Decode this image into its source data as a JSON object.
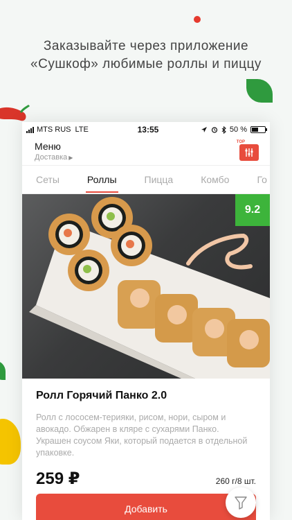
{
  "promo": {
    "line1": "Заказывайте через приложение",
    "line2": "«Сушкоф» любимые роллы и пиццу"
  },
  "status_bar": {
    "carrier": "MTS RUS",
    "network": "LTE",
    "time": "13:55",
    "battery": "50 %",
    "battery_level": 0.5
  },
  "header": {
    "title": "Меню",
    "delivery": "Доставка",
    "top_badge": "TOP"
  },
  "tabs": [
    {
      "label": "Сеты",
      "active": false
    },
    {
      "label": "Роллы",
      "active": true
    },
    {
      "label": "Пицца",
      "active": false
    },
    {
      "label": "Комбо",
      "active": false
    },
    {
      "label": "Го",
      "active": false
    }
  ],
  "product": {
    "rating": "9.2",
    "title": "Ролл Горячий Панко 2.0",
    "description": "Ролл с лососем-терияки, рисом,  нори, сыром и авокадо. Обжарен в кляре с сухарями Панко. Украшен соусом Яки, который подается в отдельной упаковке.",
    "price": "259 ₽",
    "weight": "260 г/8 шт.",
    "add_label": "Добавить"
  },
  "colors": {
    "accent": "#e84c3d",
    "rating": "#3db43b"
  }
}
